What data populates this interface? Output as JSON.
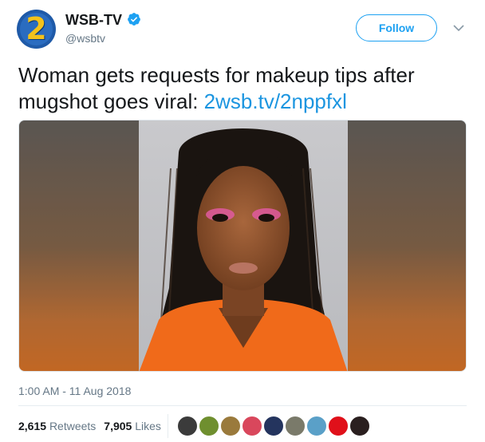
{
  "account": {
    "name": "WSB-TV",
    "handle": "@wsbtv",
    "avatar_text": "2",
    "verified": true
  },
  "follow_label": "Follow",
  "tweet": {
    "text": "Woman gets requests for makeup tips after mugshot goes viral: ",
    "link": "2wsb.tv/2nppfxl"
  },
  "timestamp": "1:00 AM - 11 Aug 2018",
  "stats": {
    "retweets_count": "2,615",
    "retweets_label": "Retweets",
    "likes_count": "7,905",
    "likes_label": "Likes"
  },
  "likers": [
    {
      "color": "#3b3b3b"
    },
    {
      "color": "#6f8f2f"
    },
    {
      "color": "#9a7a3c"
    },
    {
      "color": "#d9475c"
    },
    {
      "color": "#24345e"
    },
    {
      "color": "#7a7a6a"
    },
    {
      "color": "#5aa0c8"
    },
    {
      "color": "#e0101a"
    },
    {
      "color": "#2a1f1f"
    }
  ],
  "colors": {
    "accent": "#1da1f2",
    "link": "#1b95e0",
    "muted": "#657786",
    "avatar_bg": "#1f5aa8",
    "avatar_digit": "#f4c21b"
  }
}
